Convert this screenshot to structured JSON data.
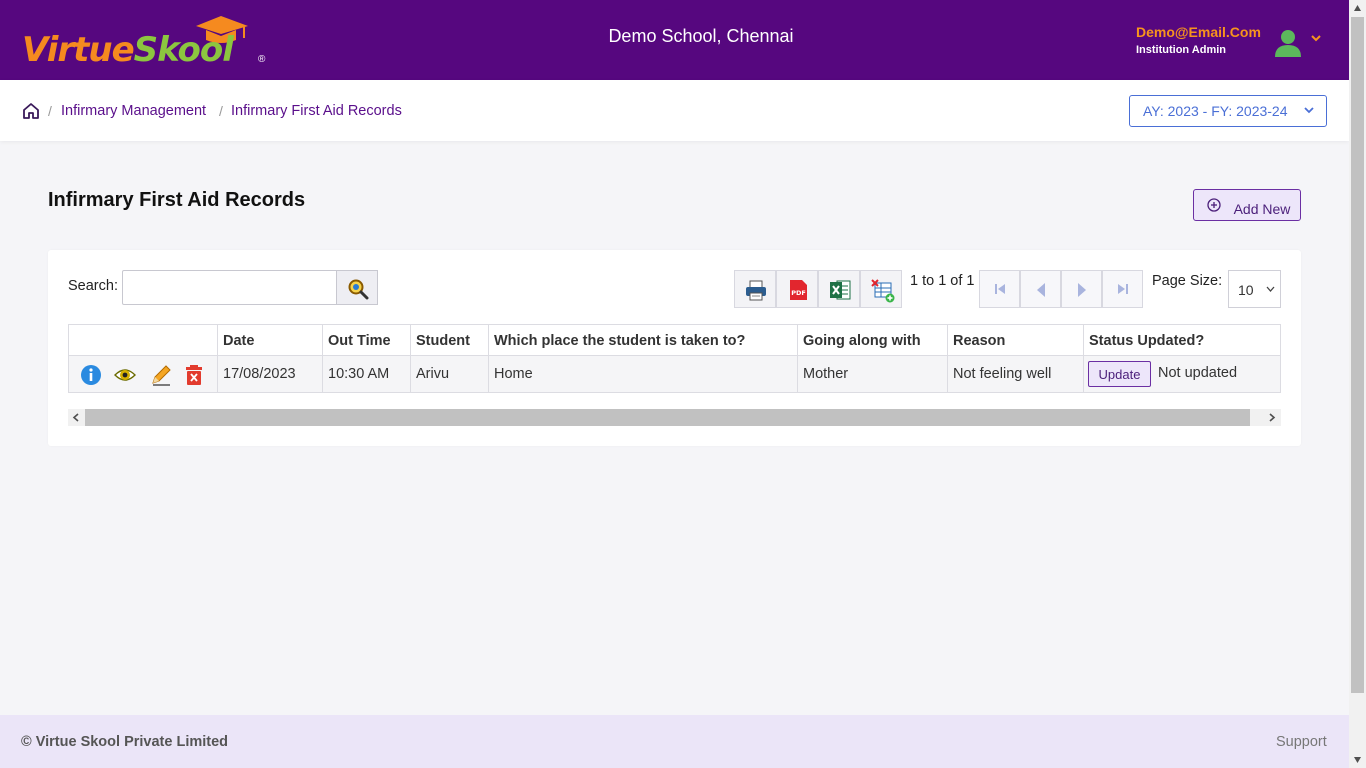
{
  "header": {
    "logo_virtue": "Virtue",
    "logo_skool": "Skool",
    "logo_reg": "®",
    "school_name": "Demo School, Chennai",
    "user_email": "Demo@Email.Com",
    "user_role": "Institution Admin",
    "brand_color": "#56077f"
  },
  "breadcrumb": {
    "sep": "/",
    "items": [
      "Infirmary Management",
      "Infirmary First Aid Records"
    ]
  },
  "year_select": {
    "value": "AY: 2023 - FY: 2023-24"
  },
  "page": {
    "title": "Infirmary First Aid Records",
    "add_label": "Add New"
  },
  "search": {
    "label": "Search:",
    "value": "",
    "placeholder": ""
  },
  "pagination": {
    "summary": "1 to 1 of 1",
    "page_size_label": "Page Size:",
    "page_size": "10"
  },
  "table": {
    "columns": [
      "",
      "Date",
      "Out Time",
      "Student",
      "Which place the student is taken to?",
      "Going along with",
      "Reason",
      "Status Updated?"
    ],
    "rows": [
      {
        "date": "17/08/2023",
        "out_time": "10:30 AM",
        "student": "Arivu",
        "place": "Home",
        "going_with": "Mother",
        "reason": "Not feeling well",
        "update_label": "Update",
        "status": "Not updated"
      }
    ]
  },
  "footer": {
    "copyright": "© Virtue Skool Private Limited",
    "support": "Support"
  },
  "icons": [
    "home-icon",
    "user-avatar-icon",
    "chevron-down-icon",
    "plus-circle-icon",
    "search-icon",
    "print-icon",
    "pdf-icon",
    "excel-icon",
    "excel-add-icon",
    "first-page-icon",
    "prev-page-icon",
    "next-page-icon",
    "last-page-icon",
    "info-icon",
    "view-icon",
    "edit-icon",
    "delete-icon"
  ]
}
